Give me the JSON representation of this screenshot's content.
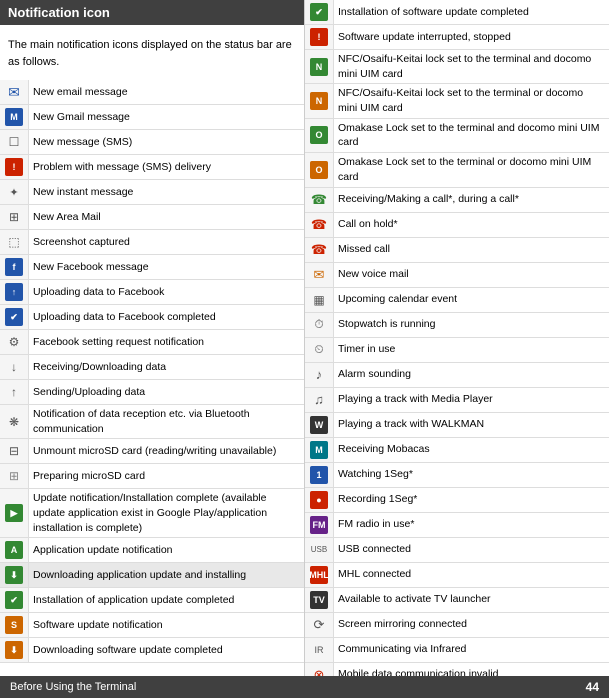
{
  "header": {
    "title": "Notification icon"
  },
  "intro": "The main notification icons displayed on the status bar are as follows.",
  "left_items": [
    {
      "icon": "✉",
      "icon_style": "color:#2255aa;font-size:14px;",
      "desc": "New email message"
    },
    {
      "icon": "M",
      "icon_style": "box bg-blue",
      "desc": "New Gmail message"
    },
    {
      "icon": "☐",
      "icon_style": "color:#555;font-size:12px;",
      "desc": "New message (SMS)"
    },
    {
      "icon": "!",
      "icon_style": "box bg-red",
      "desc": "Problem with message (SMS) delivery"
    },
    {
      "icon": "✦",
      "icon_style": "color:#555;font-size:11px;",
      "desc": "New instant message"
    },
    {
      "icon": "⊞",
      "icon_style": "color:#555;font-size:12px;",
      "desc": "New Area Mail"
    },
    {
      "icon": "⬚",
      "icon_style": "color:#555;font-size:12px;",
      "desc": "Screenshot captured"
    },
    {
      "icon": "f",
      "icon_style": "box bg-blue",
      "desc": "New Facebook message"
    },
    {
      "icon": "↑",
      "icon_style": "box bg-blue",
      "desc": "Uploading data to Facebook"
    },
    {
      "icon": "✔",
      "icon_style": "box bg-blue",
      "desc": "Uploading data to Facebook completed"
    },
    {
      "icon": "⚙",
      "icon_style": "color:#555;font-size:12px;",
      "desc": "Facebook setting request notification"
    },
    {
      "icon": "↓",
      "icon_style": "color:#555;font-size:12px;",
      "desc": "Receiving/Downloading data"
    },
    {
      "icon": "↑",
      "icon_style": "color:#555;font-size:12px;",
      "desc": "Sending/Uploading data"
    },
    {
      "icon": "❋",
      "icon_style": "color:#555;font-size:12px;",
      "desc": "Notification of data reception etc. via Bluetooth communication"
    },
    {
      "icon": "⊟",
      "icon_style": "color:#555;font-size:12px;",
      "desc": "Unmount microSD card (reading/writing unavailable)"
    },
    {
      "icon": "⊞",
      "icon_style": "color:#888;font-size:12px;",
      "desc": "Preparing microSD card"
    },
    {
      "icon": "▶",
      "icon_style": "box bg-green",
      "desc": "Update notification/Installation complete (available update application exist in Google Play/application installation is complete)"
    },
    {
      "icon": "A",
      "icon_style": "box bg-green",
      "desc": "Application update notification"
    },
    {
      "icon": "⬇",
      "icon_style": "box bg-green",
      "desc": "Downloading application update and installing",
      "highlight": true
    },
    {
      "icon": "✔",
      "icon_style": "box bg-green",
      "desc": "Installation of application update completed"
    },
    {
      "icon": "S",
      "icon_style": "box bg-orange",
      "desc": "Software update notification"
    },
    {
      "icon": "⬇",
      "icon_style": "box bg-orange",
      "desc": "Downloading software update completed"
    }
  ],
  "right_items": [
    {
      "icon": "✔",
      "icon_style": "box bg-green",
      "desc": "Installation of software update completed"
    },
    {
      "icon": "!",
      "icon_style": "box bg-red",
      "desc": "Software update interrupted, stopped"
    },
    {
      "icon": "N",
      "icon_style": "box bg-green",
      "desc": "NFC/Osaifu-Keitai lock set to the terminal and docomo mini UIM card"
    },
    {
      "icon": "N",
      "icon_style": "box bg-orange",
      "desc": "NFC/Osaifu-Keitai lock set to the terminal or docomo mini UIM card"
    },
    {
      "icon": "O",
      "icon_style": "box bg-green",
      "desc": "Omakase Lock set to the terminal and docomo mini UIM card"
    },
    {
      "icon": "O",
      "icon_style": "box bg-orange",
      "desc": "Omakase Lock set to the terminal or docomo mini UIM card"
    },
    {
      "icon": "☎",
      "icon_style": "color:#338833;font-size:13px;",
      "desc": "Receiving/Making a call*, during a call*"
    },
    {
      "icon": "☎",
      "icon_style": "color:#cc2200;font-size:13px;",
      "desc": "Call on hold*"
    },
    {
      "icon": "☎",
      "icon_style": "color:#cc2200;font-size:13px;",
      "desc": "Missed call"
    },
    {
      "icon": "✉",
      "icon_style": "color:#cc6600;font-size:13px;",
      "desc": "New voice mail"
    },
    {
      "icon": "▦",
      "icon_style": "color:#555;font-size:12px;",
      "desc": "Upcoming calendar event"
    },
    {
      "icon": "⏱",
      "icon_style": "color:#555;font-size:12px;",
      "desc": "Stopwatch is running"
    },
    {
      "icon": "⏲",
      "icon_style": "color:#555;font-size:12px;",
      "desc": "Timer in use"
    },
    {
      "icon": "♪",
      "icon_style": "color:#555;font-size:13px;",
      "desc": "Alarm sounding"
    },
    {
      "icon": "♫",
      "icon_style": "color:#555;font-size:13px;",
      "desc": "Playing a track with Media Player"
    },
    {
      "icon": "W",
      "icon_style": "box bg-dark",
      "desc": "Playing a track with WALKMAN"
    },
    {
      "icon": "M",
      "icon_style": "box bg-teal",
      "desc": "Receiving Mobacas"
    },
    {
      "icon": "1",
      "icon_style": "box bg-blue",
      "desc": "Watching 1Seg*"
    },
    {
      "icon": "●",
      "icon_style": "box bg-red",
      "desc": "Recording 1Seg*"
    },
    {
      "icon": "FM",
      "icon_style": "box bg-purple",
      "desc": "FM radio in use*"
    },
    {
      "icon": "USB",
      "icon_style": "color:#555;font-size:8px;",
      "desc": "USB connected"
    },
    {
      "icon": "MHL",
      "icon_style": "box bg-red",
      "desc": "MHL connected"
    },
    {
      "icon": "TV",
      "icon_style": "box bg-dark",
      "desc": "Available to activate TV launcher"
    },
    {
      "icon": "⟳",
      "icon_style": "color:#555;font-size:13px;",
      "desc": "Screen mirroring connected"
    },
    {
      "icon": "IR",
      "icon_style": "color:#555;font-size:9px;",
      "desc": "Communicating via Infrared"
    },
    {
      "icon": "⊗",
      "icon_style": "color:#cc2200;font-size:13px;",
      "desc": "Mobile data communication invalid"
    }
  ],
  "footer": {
    "text": "Before Using the Terminal",
    "page": "44"
  }
}
